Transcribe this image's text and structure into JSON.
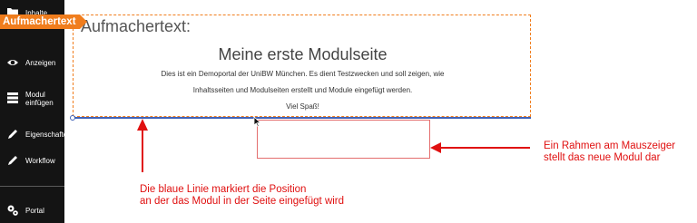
{
  "sidebar": {
    "items": [
      {
        "label": "Inhalte",
        "icon": "folder-icon"
      },
      {
        "label": "Anzeigen",
        "icon": "eye-icon"
      },
      {
        "label_line1": "Modul",
        "label_line2": "einfügen",
        "icon": "module-insert-icon"
      },
      {
        "label": "Eigenschaften",
        "icon": "pencil-icon"
      },
      {
        "label": "Workflow",
        "icon": "pencil-icon"
      },
      {
        "label": "Portal",
        "icon": "gear-icon"
      }
    ]
  },
  "tag": {
    "label": "Aufmachertext"
  },
  "module": {
    "title": "Aufmachertext:",
    "heading": "Meine erste Modulseite",
    "line1": "Dies ist ein Demoportal der UniBW München. Es dient Testzwecken und soll zeigen, wie",
    "line2": "Inhaltsseiten und Modulseiten erstellt und Module eingefügt werden.",
    "line3": "Viel Spaß!"
  },
  "annotations": {
    "right_line1": "Ein Rahmen am Mauszeiger",
    "right_line2": "stellt das neue Modul dar",
    "bottom_line1": "Die blaue Linie markiert die Position",
    "bottom_line2": "an der das Modul in der Seite eingefügt wird"
  },
  "colors": {
    "accent": "#f07d1d",
    "insert_line": "#3f62b8",
    "annotation": "#e01010",
    "sidebar": "#141414"
  }
}
